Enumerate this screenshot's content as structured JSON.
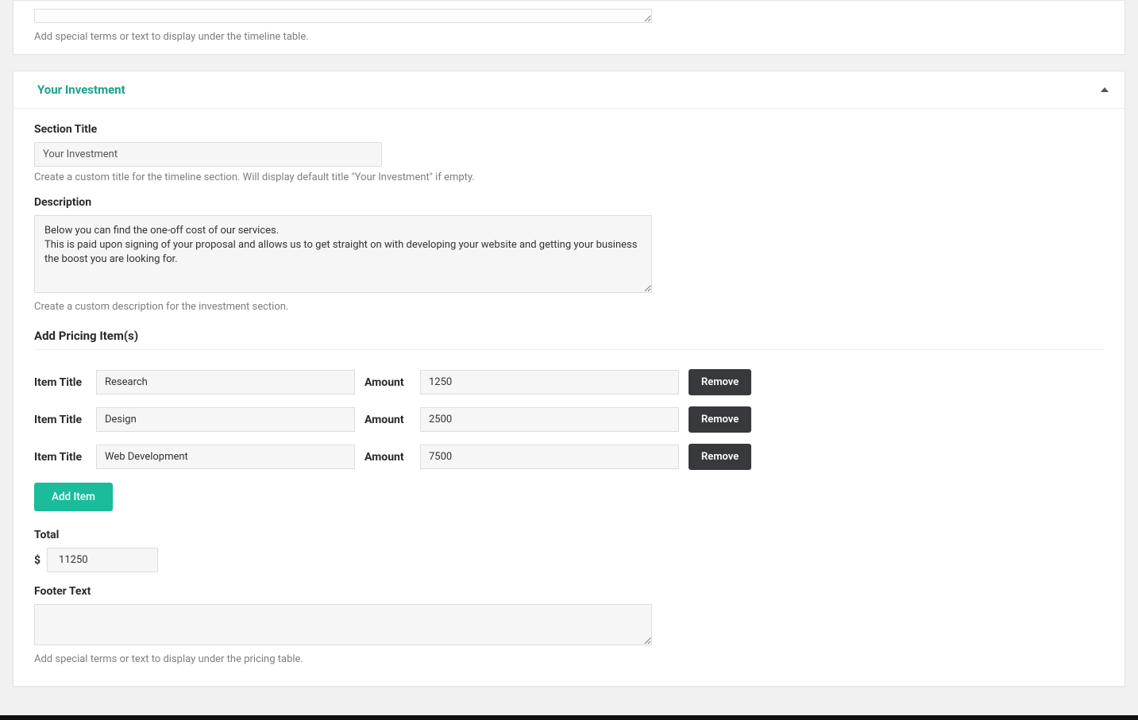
{
  "accent": "#1aa18a",
  "timeline_footer": {
    "value": "",
    "help": "Add special terms or text to display under the timeline table."
  },
  "investment": {
    "header": "Your Investment",
    "section_title": {
      "label": "Section Title",
      "value": "Your Investment",
      "help": "Create a custom title for the timeline section. Will display default title \"Your Investment\" if empty."
    },
    "description": {
      "label": "Description",
      "value": "Below you can find the one-off cost of our services.\nThis is paid upon signing of your proposal and allows us to get straight on with developing your website and getting your business the boost you are looking for.",
      "help": "Create a custom description for the investment section."
    },
    "pricing_head": "Add Pricing Item(s)",
    "row_labels": {
      "item": "Item Title",
      "amount": "Amount",
      "remove": "Remove"
    },
    "items": [
      {
        "title": "Research",
        "amount": "1250"
      },
      {
        "title": "Design",
        "amount": "2500"
      },
      {
        "title": "Web Development",
        "amount": "7500"
      }
    ],
    "add_button": "Add Item",
    "total": {
      "label": "Total",
      "currency": "$",
      "value": "11250"
    },
    "footer": {
      "label": "Footer Text",
      "value": "",
      "help": "Add special terms or text to display under the pricing table."
    }
  }
}
